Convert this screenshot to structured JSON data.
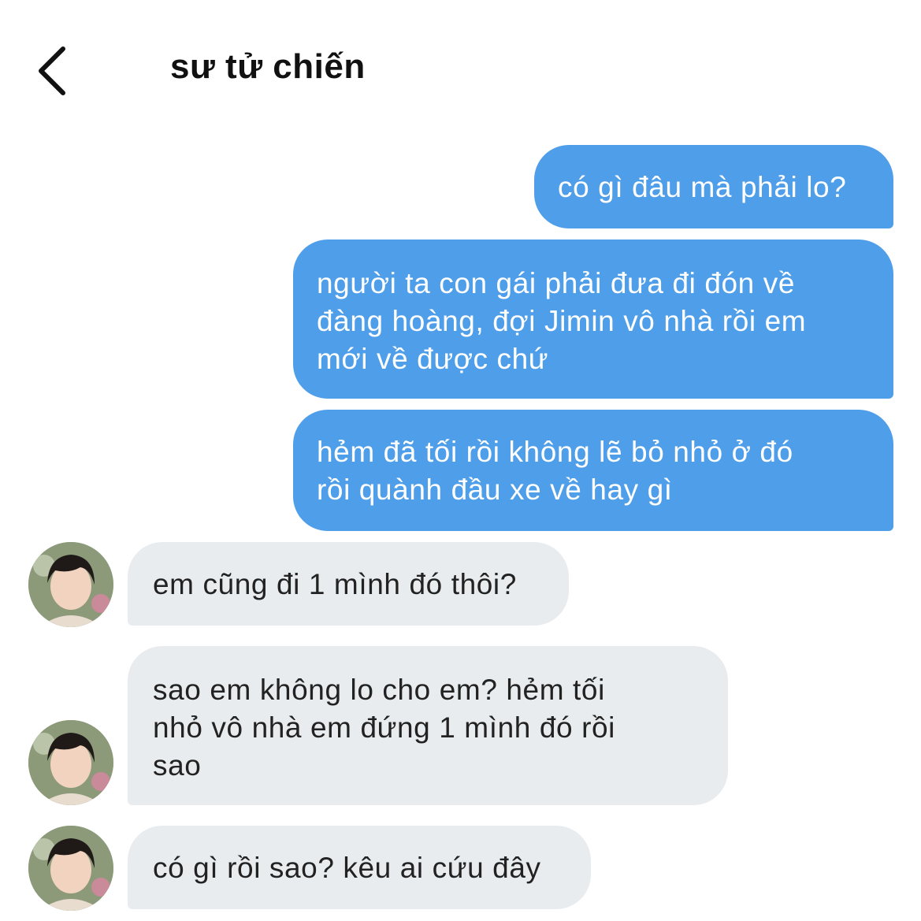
{
  "header": {
    "title": "sư tử chiến",
    "back_icon": "chevron-left-icon"
  },
  "messages": [
    {
      "from": "me",
      "lines": [
        "có gì đâu mà phải lo?"
      ]
    },
    {
      "from": "me",
      "lines": [
        "người ta con gái phải đưa đi đón về",
        "đàng hoàng, đợi Jimin vô nhà rồi em",
        "mới về được chứ"
      ]
    },
    {
      "from": "me",
      "lines": [
        "hẻm đã tối rồi không lẽ bỏ nhỏ ở đó",
        "rồi quành đầu xe về hay gì"
      ]
    },
    {
      "from": "them",
      "lines": [
        "em cũng đi 1 mình đó thôi?"
      ]
    },
    {
      "from": "them",
      "lines": [
        "sao em không lo cho em? hẻm tối",
        "nhỏ vô nhà em đứng 1 mình đó rồi",
        "sao"
      ]
    },
    {
      "from": "them",
      "lines": [
        "có gì rồi sao? kêu ai cứu đây"
      ]
    }
  ],
  "colors": {
    "outgoing_bubble": "#4f9eea",
    "incoming_bubble": "#e9ecef",
    "outgoing_text": "#ffffff",
    "incoming_text": "#222222"
  }
}
